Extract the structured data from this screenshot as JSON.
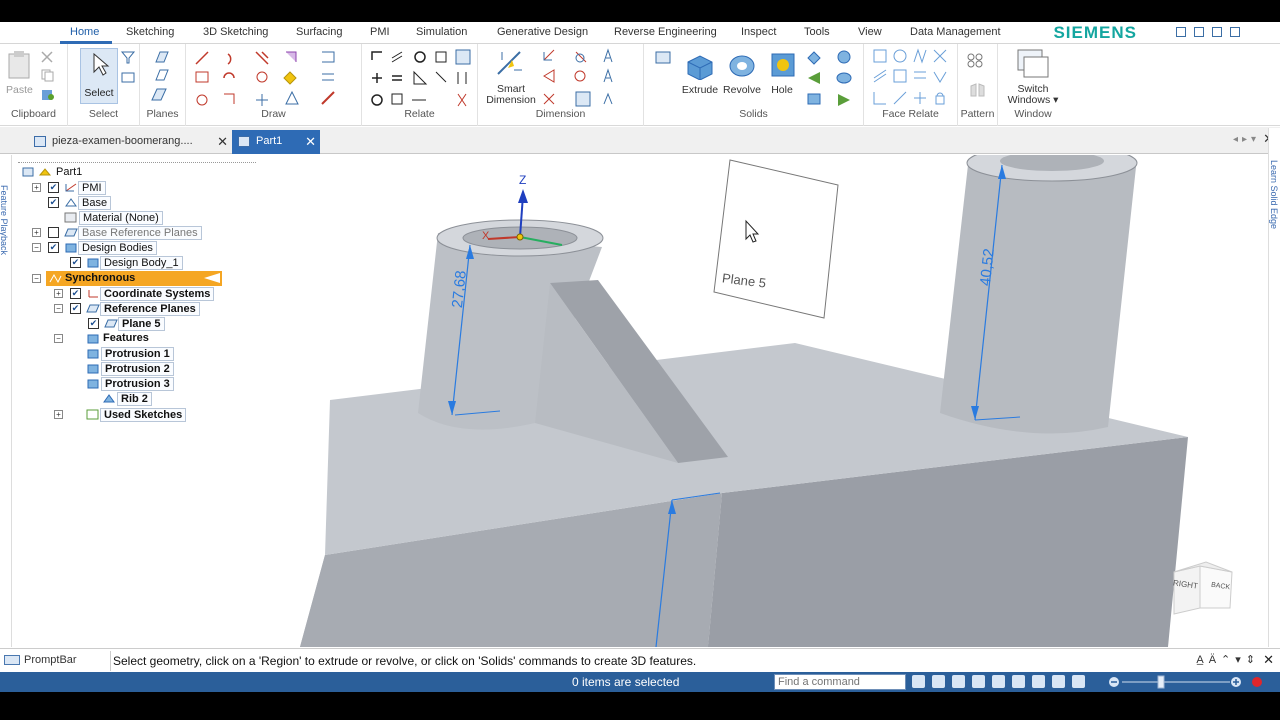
{
  "brand": "SIEMENS",
  "menu": [
    "Home",
    "Sketching",
    "3D Sketching",
    "Surfacing",
    "PMI",
    "Simulation",
    "Generative Design",
    "Reverse Engineering",
    "Inspect",
    "Tools",
    "View",
    "Data Management"
  ],
  "ribbon": {
    "clipboard": {
      "label": "Clipboard",
      "paste": "Paste"
    },
    "select": {
      "label": "Select",
      "button": "Select"
    },
    "planes": {
      "label": "Planes"
    },
    "draw": {
      "label": "Draw"
    },
    "relate": {
      "label": "Relate"
    },
    "dimension": {
      "label": "Dimension",
      "smart_dimension_1": "Smart",
      "smart_dimension_2": "Dimension"
    },
    "solids": {
      "label": "Solids",
      "extrude": "Extrude",
      "revolve": "Revolve",
      "hole": "Hole"
    },
    "face_relate": {
      "label": "Face Relate"
    },
    "pattern": {
      "label": "Pattern"
    },
    "window": {
      "label": "Window",
      "switch_windows_1": "Switch",
      "switch_windows_2": "Windows ▾"
    }
  },
  "tabs": [
    {
      "label": "pieza-examen-boomerang....",
      "close": "✕"
    },
    {
      "label": "Part1",
      "close": "✕"
    }
  ],
  "tab_bar": {
    "nav": "◂▸▾",
    "close": "✕"
  },
  "tree": {
    "part": "Part1",
    "pmi": "PMI",
    "base": "Base",
    "material": "Material (None)",
    "base_ref_planes": "Base Reference Planes",
    "design_bodies": "Design Bodies",
    "design_body_1": "Design Body_1",
    "synchronous": "Synchronous",
    "coordinate_systems": "Coordinate Systems",
    "reference_planes": "Reference Planes",
    "plane_5": "Plane 5",
    "features": "Features",
    "protrusion_1": "Protrusion 1",
    "protrusion_2": "Protrusion 2",
    "protrusion_3": "Protrusion 3",
    "rib_2": "Rib 2",
    "used_sketches": "Used Sketches",
    "expand": "+",
    "collapse": "−",
    "check": "✔"
  },
  "viewport": {
    "dim_left": "27,68",
    "dim_right": "40,52",
    "plane_label": "Plane 5",
    "z_label": "Z",
    "x_label": "X",
    "cube_right": "RIGHT",
    "cube_back": "BACK"
  },
  "left_strip": {
    "label": "Feature Playback"
  },
  "right_strip": {
    "label": "Learn Solid Edge"
  },
  "promptbar": {
    "title": "PromptBar",
    "message": "Select geometry, click on a 'Region' to extrude or revolve, or click on 'Solids' commands to create 3D features.",
    "controls": "A̲Ä⌃▾⇕",
    "close": "✕"
  },
  "status": {
    "selection": "0 items are selected",
    "find_placeholder": "Find a command"
  }
}
